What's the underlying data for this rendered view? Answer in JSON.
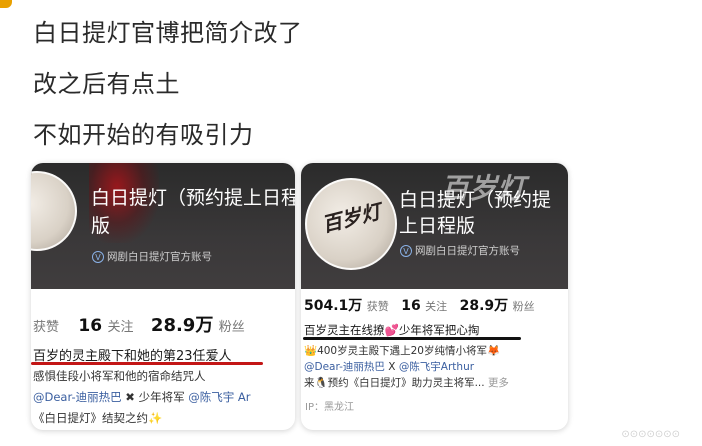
{
  "post": {
    "lines": [
      "白日提灯官博把简介改了",
      "改之后有点土",
      "不如开始的有吸引力"
    ]
  },
  "left_card": {
    "account_name": "白日提灯（预约提上日程版",
    "account_name_2": "版",
    "verification": "网剧白日提灯官方账号",
    "stats": {
      "likes_label": "获赞",
      "follow_count": "16",
      "follow_label": "关注",
      "fans_count": "28.9万",
      "fans_label": "粉丝"
    },
    "bio": "百岁的灵主殿下和她的第23任爱人",
    "sub1": "感惧佳段小将军和他的宿命结咒人",
    "sub2_link1": "@Dear-迪丽热巴",
    "sub2_x": "✖",
    "sub2_text": "少年将军",
    "sub2_link2": "@陈飞宇 Ar",
    "sub3": "《白日提灯》结契之约✨"
  },
  "right_card": {
    "brush_title": "百岁灯",
    "avatar_text": "百岁灯",
    "account_name": "白日提灯（预约提",
    "account_name_2": "上日程版",
    "verification": "网剧白日提灯官方账号",
    "stats": {
      "likes_count": "504.1万",
      "likes_label": "获赞",
      "follow_count": "16",
      "follow_label": "关注",
      "fans_count": "28.9万",
      "fans_label": "粉丝"
    },
    "bio": "百岁灵主在线撩💕少年将军把心掏",
    "sub1": "👑400岁灵主殿下遇上20岁纯情小将军🦊",
    "sub2_link1": "@Dear-迪丽热巴",
    "sub2_x": "X",
    "sub2_link2": "@陈飞宇Arthur",
    "sub3_pre": "来🐧预约《白日提灯》助力灵主将军...",
    "sub3_more": "更多",
    "ip": "IP：黑龙江"
  },
  "watermark": "⊙⊙⊙⊙⊙⊙⊙",
  "colors": {
    "underline_red": "#c31616",
    "underline_black": "#111111",
    "link": "#3b5fa0",
    "header_bg": "#2f2d2e"
  }
}
